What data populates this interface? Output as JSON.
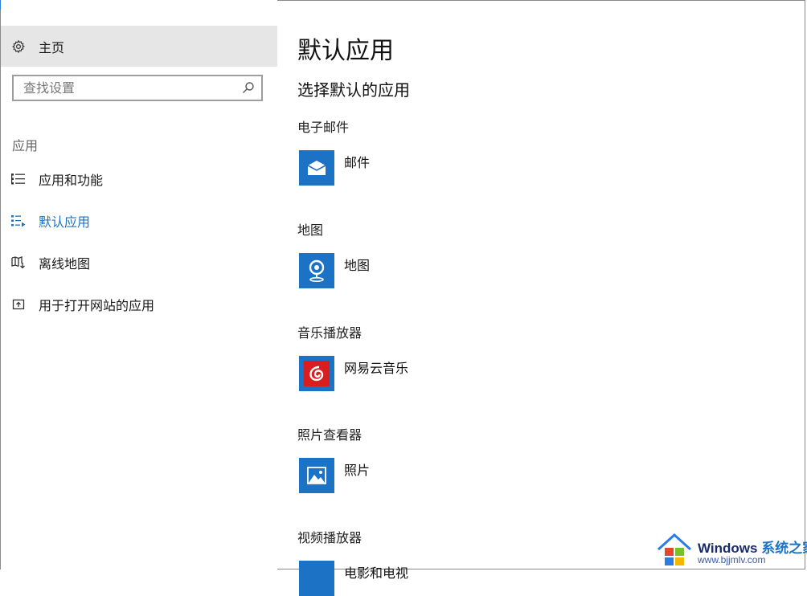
{
  "window": {
    "title_fragment": ""
  },
  "sidebar": {
    "home_label": "主页",
    "search_placeholder": "查找设置",
    "section_title": "应用",
    "items": [
      {
        "label": "应用和功能",
        "icon": "list-icon"
      },
      {
        "label": "默认应用",
        "icon": "default-apps-icon",
        "active": true
      },
      {
        "label": "离线地图",
        "icon": "offline-map-icon"
      },
      {
        "label": "用于打开网站的应用",
        "icon": "open-website-icon"
      }
    ]
  },
  "main": {
    "title": "默认应用",
    "subtitle": "选择默认的应用",
    "categories": [
      {
        "label": "电子邮件",
        "app": "邮件",
        "icon": "mail-icon"
      },
      {
        "label": "地图",
        "app": "地图",
        "icon": "maps-icon"
      },
      {
        "label": "音乐播放器",
        "app": "网易云音乐",
        "icon": "netease-music-icon"
      },
      {
        "label": "照片查看器",
        "app": "照片",
        "icon": "photos-icon"
      },
      {
        "label": "视频播放器",
        "app": "电影和电视",
        "icon": "movies-tv-icon"
      }
    ]
  },
  "watermark": {
    "brand": "Windows",
    "brand_cn": "系统之家",
    "url": "www.bjjmlv.com"
  },
  "colors": {
    "accent": "#1c72c4",
    "sidebar_home_bg": "#e6e6e6",
    "netease_red": "#d81e1e"
  }
}
